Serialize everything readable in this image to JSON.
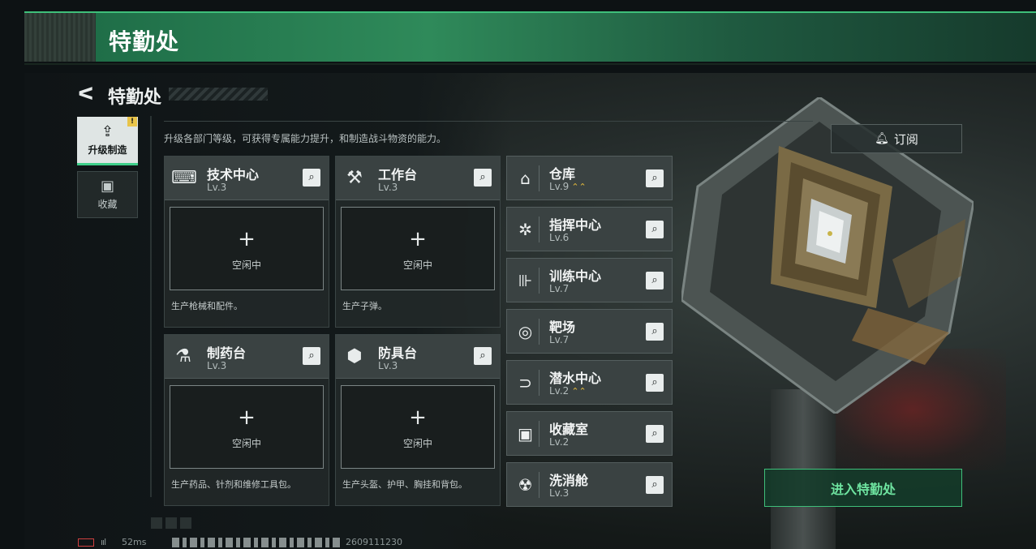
{
  "banner": {
    "title": "特勤处"
  },
  "header": {
    "back_glyph": "ᐸ",
    "title": "特勤处"
  },
  "description": "升级各部门等级，可获得专属能力提升，和制造战斗物资的能力。",
  "tabs": [
    {
      "label": "升级制造",
      "icon": "upgrade-craft-icon",
      "active": true,
      "badge": "!"
    },
    {
      "label": "收藏",
      "icon": "collection-icon",
      "active": false
    }
  ],
  "production": [
    {
      "name": "技术中心",
      "level": "Lv.3",
      "icon": "tech-center-icon",
      "slot_plus": "+",
      "slot_status": "空闲中",
      "desc": "生产枪械和配件。"
    },
    {
      "name": "工作台",
      "level": "Lv.3",
      "icon": "workbench-icon",
      "slot_plus": "+",
      "slot_status": "空闲中",
      "desc": "生产子弹。"
    },
    {
      "name": "制药台",
      "level": "Lv.3",
      "icon": "pharmacy-icon",
      "slot_plus": "+",
      "slot_status": "空闲中",
      "desc": "生产药品、针剂和维修工具包。"
    },
    {
      "name": "防具台",
      "level": "Lv.3",
      "icon": "armor-bench-icon",
      "slot_plus": "+",
      "slot_status": "空闲中",
      "desc": "生产头盔、护甲、胸挂和背包。"
    }
  ],
  "departments": [
    {
      "name": "仓库",
      "level": "Lv.9",
      "upgradable": true,
      "up_glyph": "⌃⌃",
      "icon": "warehouse-icon"
    },
    {
      "name": "指挥中心",
      "level": "Lv.6",
      "upgradable": false,
      "icon": "command-center-icon"
    },
    {
      "name": "训练中心",
      "level": "Lv.7",
      "upgradable": false,
      "icon": "training-dumbbell-icon"
    },
    {
      "name": "靶场",
      "level": "Lv.7",
      "upgradable": false,
      "icon": "target-icon"
    },
    {
      "name": "潜水中心",
      "level": "Lv.2",
      "upgradable": true,
      "up_glyph": "⌃⌃",
      "icon": "diving-mask-icon"
    },
    {
      "name": "收藏室",
      "level": "Lv.2",
      "upgradable": false,
      "icon": "collection-room-icon"
    },
    {
      "name": "洗消舱",
      "level": "Lv.3",
      "upgradable": false,
      "icon": "decontamination-icon"
    }
  ],
  "subscribe_button": "订阅",
  "enter_button": "进入特勤处",
  "status": {
    "ping": "52ms",
    "signal": "ııl",
    "build_id": "2609111230"
  },
  "icons": {
    "search": "search-icon",
    "back": "back-arrow-icon"
  },
  "colors": {
    "accent_green": "#3fbf7a",
    "upgrade_gold": "#e3b93c",
    "enter_text": "#6ee3a0"
  }
}
